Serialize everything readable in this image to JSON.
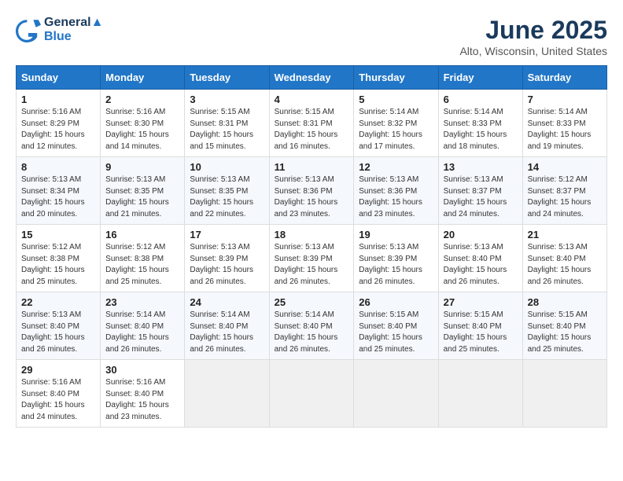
{
  "header": {
    "logo_line1": "General",
    "logo_line2": "Blue",
    "month_title": "June 2025",
    "location": "Alto, Wisconsin, United States"
  },
  "calendar": {
    "days_of_week": [
      "Sunday",
      "Monday",
      "Tuesday",
      "Wednesday",
      "Thursday",
      "Friday",
      "Saturday"
    ],
    "weeks": [
      [
        null,
        null,
        null,
        null,
        null,
        null,
        null
      ]
    ]
  },
  "cells": {
    "empty": "",
    "w1": [
      {
        "day": "1",
        "info": "Sunrise: 5:16 AM\nSunset: 8:29 PM\nDaylight: 15 hours\nand 12 minutes."
      },
      {
        "day": "2",
        "info": "Sunrise: 5:16 AM\nSunset: 8:30 PM\nDaylight: 15 hours\nand 14 minutes."
      },
      {
        "day": "3",
        "info": "Sunrise: 5:15 AM\nSunset: 8:31 PM\nDaylight: 15 hours\nand 15 minutes."
      },
      {
        "day": "4",
        "info": "Sunrise: 5:15 AM\nSunset: 8:31 PM\nDaylight: 15 hours\nand 16 minutes."
      },
      {
        "day": "5",
        "info": "Sunrise: 5:14 AM\nSunset: 8:32 PM\nDaylight: 15 hours\nand 17 minutes."
      },
      {
        "day": "6",
        "info": "Sunrise: 5:14 AM\nSunset: 8:33 PM\nDaylight: 15 hours\nand 18 minutes."
      },
      {
        "day": "7",
        "info": "Sunrise: 5:14 AM\nSunset: 8:33 PM\nDaylight: 15 hours\nand 19 minutes."
      }
    ],
    "w2": [
      {
        "day": "8",
        "info": "Sunrise: 5:13 AM\nSunset: 8:34 PM\nDaylight: 15 hours\nand 20 minutes."
      },
      {
        "day": "9",
        "info": "Sunrise: 5:13 AM\nSunset: 8:35 PM\nDaylight: 15 hours\nand 21 minutes."
      },
      {
        "day": "10",
        "info": "Sunrise: 5:13 AM\nSunset: 8:35 PM\nDaylight: 15 hours\nand 22 minutes."
      },
      {
        "day": "11",
        "info": "Sunrise: 5:13 AM\nSunset: 8:36 PM\nDaylight: 15 hours\nand 23 minutes."
      },
      {
        "day": "12",
        "info": "Sunrise: 5:13 AM\nSunset: 8:36 PM\nDaylight: 15 hours\nand 23 minutes."
      },
      {
        "day": "13",
        "info": "Sunrise: 5:13 AM\nSunset: 8:37 PM\nDaylight: 15 hours\nand 24 minutes."
      },
      {
        "day": "14",
        "info": "Sunrise: 5:12 AM\nSunset: 8:37 PM\nDaylight: 15 hours\nand 24 minutes."
      }
    ],
    "w3": [
      {
        "day": "15",
        "info": "Sunrise: 5:12 AM\nSunset: 8:38 PM\nDaylight: 15 hours\nand 25 minutes."
      },
      {
        "day": "16",
        "info": "Sunrise: 5:12 AM\nSunset: 8:38 PM\nDaylight: 15 hours\nand 25 minutes."
      },
      {
        "day": "17",
        "info": "Sunrise: 5:13 AM\nSunset: 8:39 PM\nDaylight: 15 hours\nand 26 minutes."
      },
      {
        "day": "18",
        "info": "Sunrise: 5:13 AM\nSunset: 8:39 PM\nDaylight: 15 hours\nand 26 minutes."
      },
      {
        "day": "19",
        "info": "Sunrise: 5:13 AM\nSunset: 8:39 PM\nDaylight: 15 hours\nand 26 minutes."
      },
      {
        "day": "20",
        "info": "Sunrise: 5:13 AM\nSunset: 8:40 PM\nDaylight: 15 hours\nand 26 minutes."
      },
      {
        "day": "21",
        "info": "Sunrise: 5:13 AM\nSunset: 8:40 PM\nDaylight: 15 hours\nand 26 minutes."
      }
    ],
    "w4": [
      {
        "day": "22",
        "info": "Sunrise: 5:13 AM\nSunset: 8:40 PM\nDaylight: 15 hours\nand 26 minutes."
      },
      {
        "day": "23",
        "info": "Sunrise: 5:14 AM\nSunset: 8:40 PM\nDaylight: 15 hours\nand 26 minutes."
      },
      {
        "day": "24",
        "info": "Sunrise: 5:14 AM\nSunset: 8:40 PM\nDaylight: 15 hours\nand 26 minutes."
      },
      {
        "day": "25",
        "info": "Sunrise: 5:14 AM\nSunset: 8:40 PM\nDaylight: 15 hours\nand 26 minutes."
      },
      {
        "day": "26",
        "info": "Sunrise: 5:15 AM\nSunset: 8:40 PM\nDaylight: 15 hours\nand 25 minutes."
      },
      {
        "day": "27",
        "info": "Sunrise: 5:15 AM\nSunset: 8:40 PM\nDaylight: 15 hours\nand 25 minutes."
      },
      {
        "day": "28",
        "info": "Sunrise: 5:15 AM\nSunset: 8:40 PM\nDaylight: 15 hours\nand 25 minutes."
      }
    ],
    "w5": [
      {
        "day": "29",
        "info": "Sunrise: 5:16 AM\nSunset: 8:40 PM\nDaylight: 15 hours\nand 24 minutes."
      },
      {
        "day": "30",
        "info": "Sunrise: 5:16 AM\nSunset: 8:40 PM\nDaylight: 15 hours\nand 23 minutes."
      },
      null,
      null,
      null,
      null,
      null
    ]
  }
}
